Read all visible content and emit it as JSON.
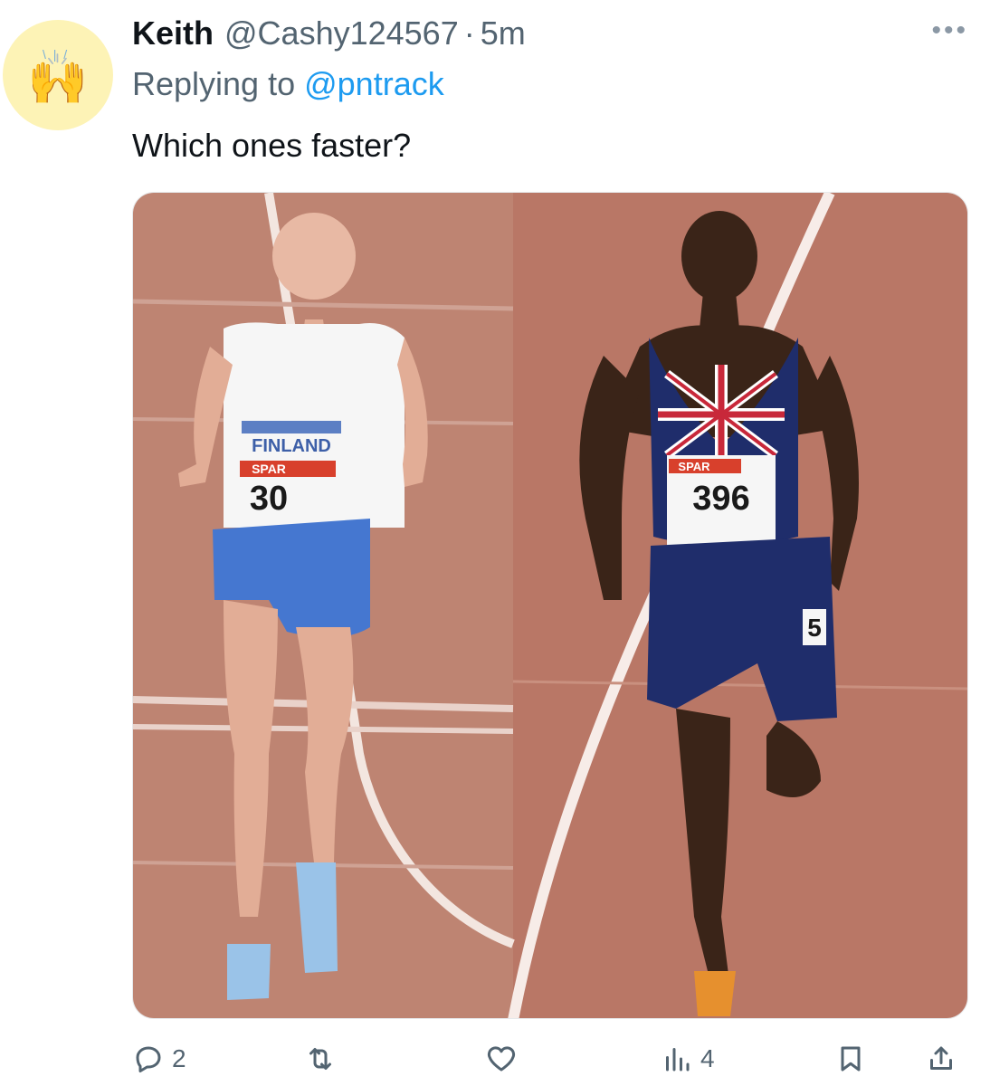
{
  "author": {
    "display_name": "Keith",
    "handle": "@Cashy124567",
    "separator": "·",
    "time": "5m",
    "avatar_emoji": "🙌"
  },
  "reply": {
    "prefix": "Replying to ",
    "mention": "@pntrack"
  },
  "body": {
    "text": "Which ones faster?"
  },
  "media": {
    "left_bib_country": "FINLAND",
    "left_bib_sponsor": "SPAR",
    "left_bib_number": "30",
    "right_bib_sponsor": "SPAR",
    "right_bib_number": "396",
    "right_lane_number": "5"
  },
  "actions": {
    "reply_count": "2",
    "retweet_count": "",
    "like_count": "",
    "views_count": "4"
  },
  "icons": {
    "more": "more-horizontal-icon",
    "reply": "reply-bubble-icon",
    "retweet": "retweet-icon",
    "like": "heart-icon",
    "views": "views-bar-chart-icon",
    "bookmark": "bookmark-icon",
    "share": "share-upload-icon"
  },
  "colors": {
    "link": "#1d9bf0",
    "secondary_text": "#536471",
    "primary_text": "#0f1419",
    "avatar_bg": "#fdf3b6",
    "track": "#b97766"
  }
}
